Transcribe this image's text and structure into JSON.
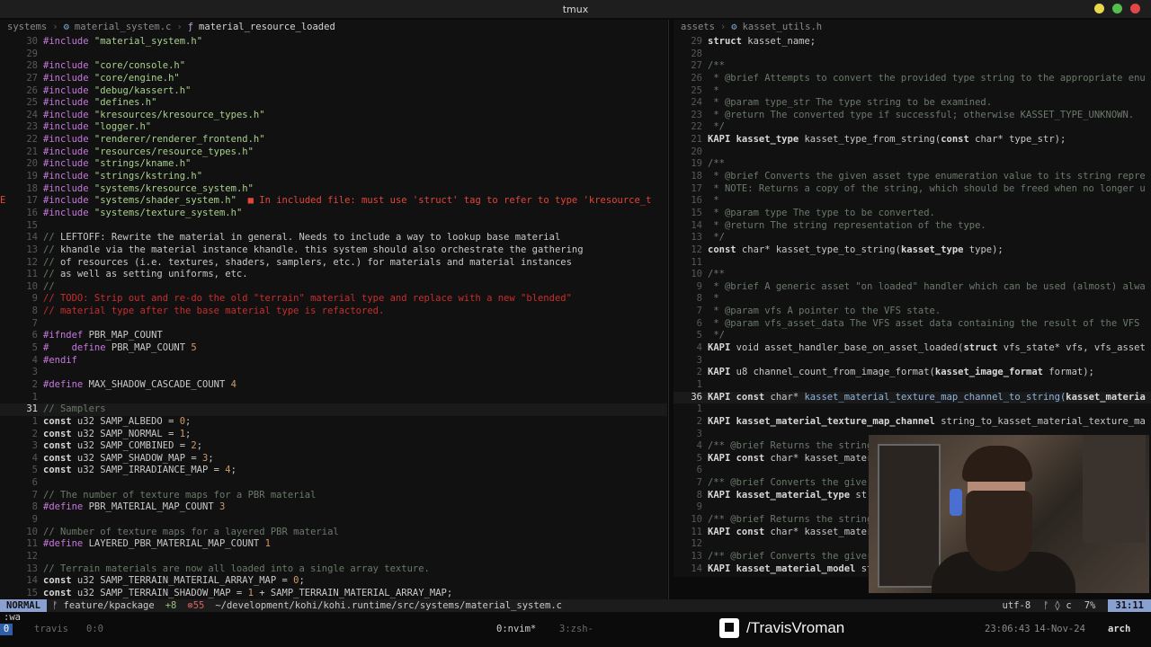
{
  "window": {
    "title": "tmux"
  },
  "left_pane": {
    "breadcrumb": [
      "systems",
      "material_system.c",
      "material_resource_loaded"
    ],
    "lines": [
      {
        "n": "30",
        "parts": [
          [
            "k",
            "#include"
          ],
          [
            "t",
            " "
          ],
          [
            "s",
            "\"material_system.h\""
          ]
        ]
      },
      {
        "n": "29",
        "parts": []
      },
      {
        "n": "28",
        "parts": [
          [
            "k",
            "#include"
          ],
          [
            "t",
            " "
          ],
          [
            "s",
            "\"core/console.h\""
          ]
        ]
      },
      {
        "n": "27",
        "parts": [
          [
            "k",
            "#include"
          ],
          [
            "t",
            " "
          ],
          [
            "s",
            "\"core/engine.h\""
          ]
        ]
      },
      {
        "n": "26",
        "parts": [
          [
            "k",
            "#include"
          ],
          [
            "t",
            " "
          ],
          [
            "s",
            "\"debug/kassert.h\""
          ]
        ]
      },
      {
        "n": "25",
        "parts": [
          [
            "k",
            "#include"
          ],
          [
            "t",
            " "
          ],
          [
            "s",
            "\"defines.h\""
          ]
        ]
      },
      {
        "n": "24",
        "parts": [
          [
            "k",
            "#include"
          ],
          [
            "t",
            " "
          ],
          [
            "s",
            "\"kresources/kresource_types.h\""
          ]
        ]
      },
      {
        "n": "23",
        "parts": [
          [
            "k",
            "#include"
          ],
          [
            "t",
            " "
          ],
          [
            "s",
            "\"logger.h\""
          ]
        ]
      },
      {
        "n": "22",
        "parts": [
          [
            "k",
            "#include"
          ],
          [
            "t",
            " "
          ],
          [
            "s",
            "\"renderer/renderer_frontend.h\""
          ]
        ]
      },
      {
        "n": "21",
        "parts": [
          [
            "k",
            "#include"
          ],
          [
            "t",
            " "
          ],
          [
            "s",
            "\"resources/resource_types.h\""
          ]
        ]
      },
      {
        "n": "20",
        "parts": [
          [
            "k",
            "#include"
          ],
          [
            "t",
            " "
          ],
          [
            "s",
            "\"strings/kname.h\""
          ]
        ]
      },
      {
        "n": "19",
        "parts": [
          [
            "k",
            "#include"
          ],
          [
            "t",
            " "
          ],
          [
            "s",
            "\"strings/kstring.h\""
          ]
        ]
      },
      {
        "n": "18",
        "parts": [
          [
            "k",
            "#include"
          ],
          [
            "t",
            " "
          ],
          [
            "s",
            "\"systems/kresource_system.h\""
          ]
        ]
      },
      {
        "n": "17",
        "sign": "E",
        "parts": [
          [
            "k",
            "#include"
          ],
          [
            "t",
            " "
          ],
          [
            "s",
            "\"systems/shader_system.h\""
          ],
          [
            "t",
            "  "
          ],
          [
            "err",
            "■ In included file: must use 'struct' tag to refer to type 'kresource_t"
          ]
        ]
      },
      {
        "n": "16",
        "parts": [
          [
            "k",
            "#include"
          ],
          [
            "t",
            " "
          ],
          [
            "s",
            "\"systems/texture_system.h\""
          ]
        ]
      },
      {
        "n": "15",
        "parts": []
      },
      {
        "n": "14",
        "parts": [
          [
            "cm",
            "// "
          ],
          [
            "t",
            "LEFTOFF: Rewrite the material in general. Needs to include a way to lookup base material"
          ]
        ]
      },
      {
        "n": "13",
        "parts": [
          [
            "cm",
            "// "
          ],
          [
            "t",
            "khandle via the material instance khandle. this system should also orchestrate the gathering"
          ]
        ]
      },
      {
        "n": "12",
        "parts": [
          [
            "cm",
            "// "
          ],
          [
            "t",
            "of resources (i.e. textures, shaders, samplers, etc.) for materials and material instances"
          ]
        ]
      },
      {
        "n": "11",
        "parts": [
          [
            "cm",
            "// "
          ],
          [
            "t",
            "as well as setting uniforms, etc."
          ]
        ]
      },
      {
        "n": "10",
        "parts": [
          [
            "cm",
            "//"
          ]
        ]
      },
      {
        "n": "9",
        "parts": [
          [
            "todo",
            "// TODO: Strip out and re-do the old \"terrain\" material type and replace with a new \"blended\""
          ]
        ]
      },
      {
        "n": "8",
        "parts": [
          [
            "todo",
            "// material type after the base material type is refactored."
          ]
        ]
      },
      {
        "n": "7",
        "parts": []
      },
      {
        "n": "6",
        "parts": [
          [
            "k",
            "#ifndef"
          ],
          [
            "t",
            " PBR_MAP_COUNT"
          ]
        ]
      },
      {
        "n": "5",
        "parts": [
          [
            "k",
            "#    define"
          ],
          [
            "t",
            " PBR_MAP_COUNT "
          ],
          [
            "num",
            "5"
          ]
        ]
      },
      {
        "n": "4",
        "parts": [
          [
            "k",
            "#endif"
          ]
        ]
      },
      {
        "n": "3",
        "parts": []
      },
      {
        "n": "2",
        "parts": [
          [
            "k",
            "#define"
          ],
          [
            "t",
            " MAX_SHADOW_CASCADE_COUNT "
          ],
          [
            "num",
            "4"
          ]
        ]
      },
      {
        "n": "1",
        "parts": []
      },
      {
        "n": "31",
        "cur": true,
        "parts": [
          [
            "cm",
            "// Samplers"
          ]
        ]
      },
      {
        "n": "1",
        "parts": [
          [
            "kw",
            "const"
          ],
          [
            "t",
            " u32 SAMP_ALBEDO = "
          ],
          [
            "num",
            "0"
          ],
          [
            "t",
            ";"
          ]
        ]
      },
      {
        "n": "2",
        "parts": [
          [
            "kw",
            "const"
          ],
          [
            "t",
            " u32 SAMP_NORMAL = "
          ],
          [
            "num",
            "1"
          ],
          [
            "t",
            ";"
          ]
        ]
      },
      {
        "n": "3",
        "parts": [
          [
            "kw",
            "const"
          ],
          [
            "t",
            " u32 SAMP_COMBINED = "
          ],
          [
            "num",
            "2"
          ],
          [
            "t",
            ";"
          ]
        ]
      },
      {
        "n": "4",
        "parts": [
          [
            "kw",
            "const"
          ],
          [
            "t",
            " u32 SAMP_SHADOW_MAP = "
          ],
          [
            "num",
            "3"
          ],
          [
            "t",
            ";"
          ]
        ]
      },
      {
        "n": "5",
        "parts": [
          [
            "kw",
            "const"
          ],
          [
            "t",
            " u32 SAMP_IRRADIANCE_MAP = "
          ],
          [
            "num",
            "4"
          ],
          [
            "t",
            ";"
          ]
        ]
      },
      {
        "n": "6",
        "parts": []
      },
      {
        "n": "7",
        "parts": [
          [
            "cm",
            "// The number of texture maps for a PBR material"
          ]
        ]
      },
      {
        "n": "8",
        "parts": [
          [
            "k",
            "#define"
          ],
          [
            "t",
            " PBR_MATERIAL_MAP_COUNT "
          ],
          [
            "num",
            "3"
          ]
        ]
      },
      {
        "n": "9",
        "parts": []
      },
      {
        "n": "10",
        "parts": [
          [
            "cm",
            "// Number of texture maps for a layered PBR material"
          ]
        ]
      },
      {
        "n": "11",
        "parts": [
          [
            "k",
            "#define"
          ],
          [
            "t",
            " LAYERED_PBR_MATERIAL_MAP_COUNT "
          ],
          [
            "num",
            "1"
          ]
        ]
      },
      {
        "n": "12",
        "parts": []
      },
      {
        "n": "13",
        "parts": [
          [
            "cm",
            "// Terrain materials are now all loaded into a single array texture."
          ]
        ]
      },
      {
        "n": "14",
        "parts": [
          [
            "kw",
            "const"
          ],
          [
            "t",
            " u32 SAMP_TERRAIN_MATERIAL_ARRAY_MAP = "
          ],
          [
            "num",
            "0"
          ],
          [
            "t",
            ";"
          ]
        ]
      },
      {
        "n": "15",
        "parts": [
          [
            "kw",
            "const"
          ],
          [
            "t",
            " u32 SAMP_TERRAIN_SHADOW_MAP = "
          ],
          [
            "num",
            "1"
          ],
          [
            "t",
            " + SAMP_TERRAIN_MATERIAL_ARRAY_MAP;"
          ]
        ]
      }
    ]
  },
  "right_pane": {
    "breadcrumb": [
      "assets",
      "kasset_utils.h"
    ],
    "lines": [
      {
        "n": "29",
        "parts": [
          [
            "kw",
            "struct"
          ],
          [
            "t",
            " kasset_name;"
          ]
        ]
      },
      {
        "n": "28",
        "parts": []
      },
      {
        "n": "27",
        "parts": [
          [
            "cm",
            "/**"
          ]
        ]
      },
      {
        "n": "26",
        "parts": [
          [
            "cm",
            " * @brief Attempts to convert the provided type string to the appropriate enu"
          ]
        ]
      },
      {
        "n": "25",
        "parts": [
          [
            "cm",
            " *"
          ]
        ]
      },
      {
        "n": "24",
        "parts": [
          [
            "cm",
            " * @param type_str The type string to be examined."
          ]
        ]
      },
      {
        "n": "23",
        "parts": [
          [
            "cm",
            " * @return The converted type if successful; otherwise KASSET_TYPE_UNKNOWN."
          ]
        ]
      },
      {
        "n": "22",
        "parts": [
          [
            "cm",
            " */"
          ]
        ]
      },
      {
        "n": "21",
        "parts": [
          [
            "kw",
            "KAPI kasset_type"
          ],
          [
            "t",
            " kasset_type_from_string("
          ],
          [
            "kw",
            "const"
          ],
          [
            "t",
            " char* type_str);"
          ]
        ]
      },
      {
        "n": "20",
        "parts": []
      },
      {
        "n": "19",
        "parts": [
          [
            "cm",
            "/**"
          ]
        ]
      },
      {
        "n": "18",
        "parts": [
          [
            "cm",
            " * @brief Converts the given asset type enumeration value to its string repre"
          ]
        ]
      },
      {
        "n": "17",
        "parts": [
          [
            "cm",
            " * NOTE: Returns a copy of the string, which should be freed when no longer u"
          ]
        ]
      },
      {
        "n": "16",
        "parts": [
          [
            "cm",
            " *"
          ]
        ]
      },
      {
        "n": "15",
        "parts": [
          [
            "cm",
            " * @param type The type to be converted."
          ]
        ]
      },
      {
        "n": "14",
        "parts": [
          [
            "cm",
            " * @return The string representation of the type."
          ]
        ]
      },
      {
        "n": "13",
        "parts": [
          [
            "cm",
            " */"
          ]
        ]
      },
      {
        "n": "12",
        "parts": [
          [
            "kw",
            "const"
          ],
          [
            "t",
            " char* kasset_type_to_string("
          ],
          [
            "kw",
            "kasset_type"
          ],
          [
            "t",
            " type);"
          ]
        ]
      },
      {
        "n": "11",
        "parts": []
      },
      {
        "n": "10",
        "parts": [
          [
            "cm",
            "/**"
          ]
        ]
      },
      {
        "n": "9",
        "parts": [
          [
            "cm",
            " * @brief A generic asset \"on loaded\" handler which can be used (almost) alwa"
          ]
        ]
      },
      {
        "n": "8",
        "parts": [
          [
            "cm",
            " *"
          ]
        ]
      },
      {
        "n": "7",
        "parts": [
          [
            "cm",
            " * @param vfs A pointer to the VFS state."
          ]
        ]
      },
      {
        "n": "6",
        "parts": [
          [
            "cm",
            " * @param vfs_asset_data The VFS asset data containing the result of the VFS"
          ]
        ]
      },
      {
        "n": "5",
        "parts": [
          [
            "cm",
            " */"
          ]
        ]
      },
      {
        "n": "4",
        "parts": [
          [
            "kw",
            "KAPI"
          ],
          [
            "t",
            " void asset_handler_base_on_asset_loaded("
          ],
          [
            "kw",
            "struct"
          ],
          [
            "t",
            " vfs_state* vfs, vfs_asset"
          ]
        ]
      },
      {
        "n": "3",
        "parts": []
      },
      {
        "n": "2",
        "parts": [
          [
            "kw",
            "KAPI"
          ],
          [
            "t",
            " u8 channel_count_from_image_format("
          ],
          [
            "kw",
            "kasset_image_format"
          ],
          [
            "t",
            " format);"
          ]
        ]
      },
      {
        "n": "1",
        "parts": []
      },
      {
        "n": "36",
        "cur": true,
        "parts": [
          [
            "kw",
            "KAPI const"
          ],
          [
            "t",
            " char* "
          ],
          [
            "fn",
            "kasset_material_texture_map_channel_to_string("
          ],
          [
            "kw",
            "kasset_materia"
          ]
        ]
      },
      {
        "n": "1",
        "parts": []
      },
      {
        "n": "2",
        "parts": [
          [
            "kw",
            "KAPI kasset_material_texture_map_channel"
          ],
          [
            "t",
            " string_to_kasset_material_texture_ma"
          ]
        ]
      },
      {
        "n": "3",
        "parts": []
      },
      {
        "n": "4",
        "parts": [
          [
            "cm",
            "/** @brief Returns the string"
          ]
        ]
      },
      {
        "n": "5",
        "parts": [
          [
            "kw",
            "KAPI const"
          ],
          [
            "t",
            " char* kasset_mater"
          ]
        ]
      },
      {
        "n": "6",
        "parts": []
      },
      {
        "n": "7",
        "parts": [
          [
            "cm",
            "/** @brief Converts the give"
          ]
        ]
      },
      {
        "n": "8",
        "parts": [
          [
            "kw",
            "KAPI kasset_material_type"
          ],
          [
            "t",
            " st"
          ]
        ]
      },
      {
        "n": "9",
        "parts": []
      },
      {
        "n": "10",
        "parts": [
          [
            "cm",
            "/** @brief Returns the string"
          ]
        ]
      },
      {
        "n": "11",
        "parts": [
          [
            "kw",
            "KAPI const"
          ],
          [
            "t",
            " char* kasset_mater"
          ]
        ]
      },
      {
        "n": "12",
        "parts": []
      },
      {
        "n": "13",
        "parts": [
          [
            "cm",
            "/** @brief Converts the giver"
          ]
        ]
      },
      {
        "n": "14",
        "parts": [
          [
            "kw",
            "KAPI kasset_material_model"
          ],
          [
            "t",
            " st"
          ]
        ]
      }
    ]
  },
  "statusbar": {
    "mode": "NORMAL",
    "branch": "ᚠ feature/kpackage",
    "added": "+8",
    "errors": "⊗55",
    "path": "~/development/kohi/kohi.runtime/src/systems/material_system.c",
    "encoding": "utf-8",
    "icons": "ᚠ ◊ c",
    "percent": "7%",
    "position": "31:11"
  },
  "cmdline": ":wa",
  "tmux": {
    "session_index": "0",
    "session_name": "travis",
    "window0": "0:0",
    "window1": "0:nvim*",
    "window2": "3:zsh-",
    "time": "23:06:43",
    "date": "14-Nov-24",
    "host": "arch"
  },
  "overlay": {
    "twitch_handle": "/TravisVroman"
  },
  "colors": {
    "mode_bg": "#8aa0d0",
    "error": "#e0463c",
    "string": "#a9d18e",
    "preproc": "#c678dd"
  }
}
